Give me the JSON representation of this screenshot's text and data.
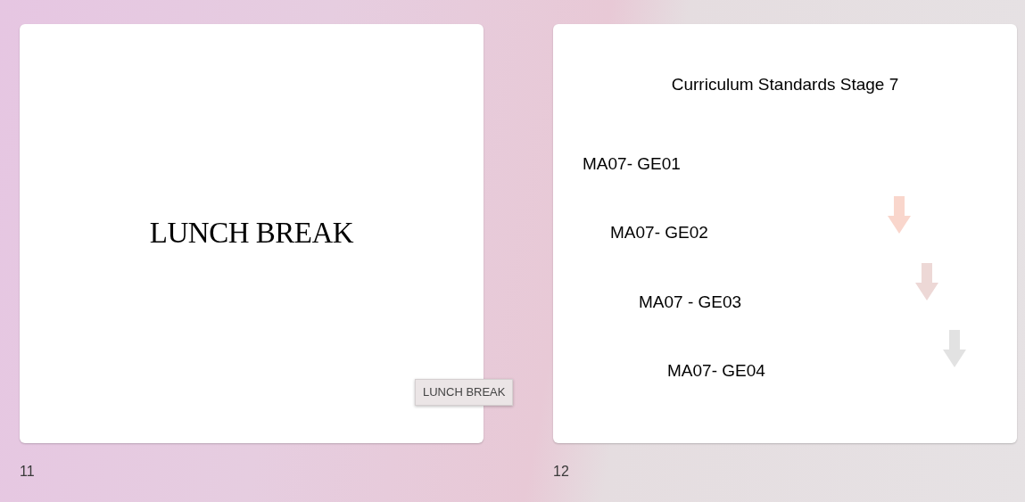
{
  "slides": [
    {
      "number": "11",
      "kind": "title",
      "title": "LUNCH BREAK",
      "tooltip": "LUNCH BREAK"
    },
    {
      "number": "12",
      "kind": "list",
      "title": "Curriculum Standards Stage 7",
      "items": [
        "MA07- GE01",
        "MA07- GE02",
        "MA07 - GE03",
        "MA07- GE04"
      ],
      "arrows": [
        {
          "color": "#f9d6cc"
        },
        {
          "color": "#edd8d6"
        },
        {
          "color": "#e2e2e2"
        }
      ]
    }
  ]
}
